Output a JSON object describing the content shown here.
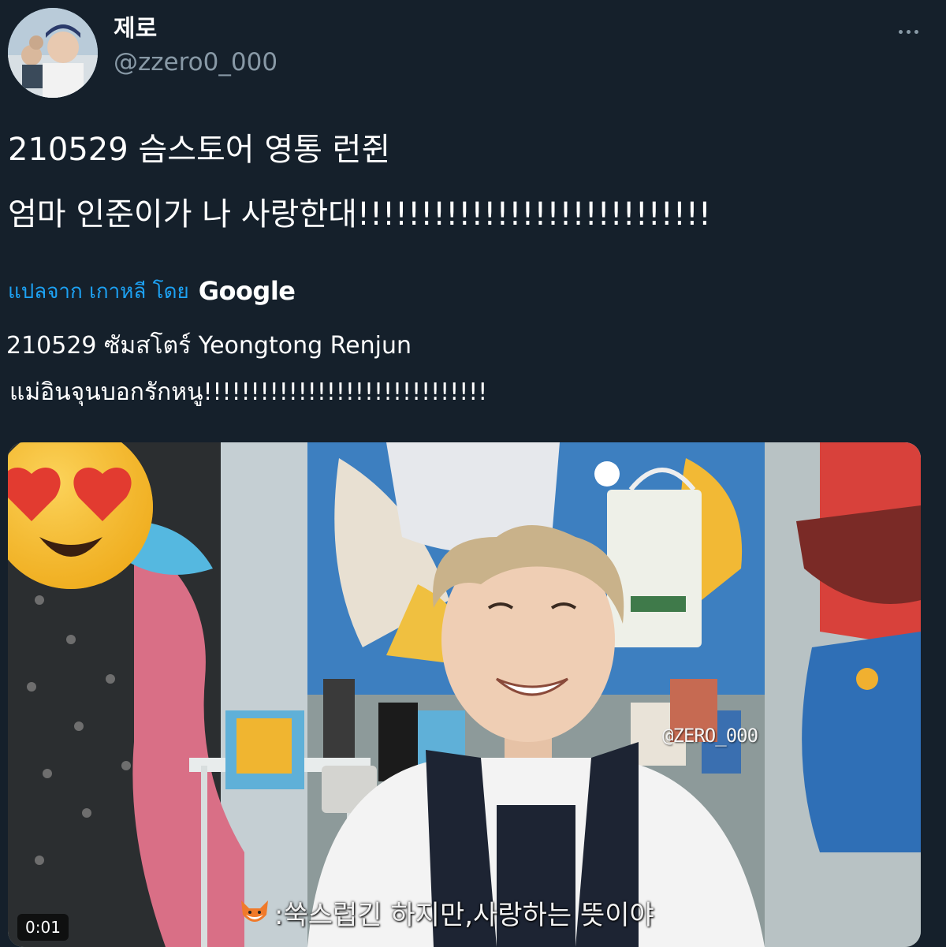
{
  "author": {
    "display_name": "제로",
    "handle": "@zzero0_000"
  },
  "tweet": {
    "lines": [
      "210529 슴스토어 영통 런쥔",
      "엄마 인준이가 나 사랑한대!!!!!!!!!!!!!!!!!!!!!!!!!!!!"
    ]
  },
  "translation": {
    "label": "แปลจาก เกาหลี โดย",
    "provider": "Google",
    "lines": [
      "210529 ซัมสโตร์ Yeongtong Renjun",
      "แม่อินจุนบอกรักหนู!!!!!!!!!!!!!!!!!!!!!!!!!!!!!!"
    ]
  },
  "media": {
    "watermark": "@ZERO_000",
    "subtitle": ":쑥스럽긴 하지만,사랑하는 뜻이야",
    "timestamp": "0:01"
  },
  "icons": {
    "menu": "more-horizontal-icon",
    "overlay": "heart-eyes-emoji-icon",
    "subtitle_mark": "fox-icon"
  },
  "colors": {
    "background": "#15202b",
    "link": "#1da1f2",
    "secondary_text": "#8899a6"
  }
}
